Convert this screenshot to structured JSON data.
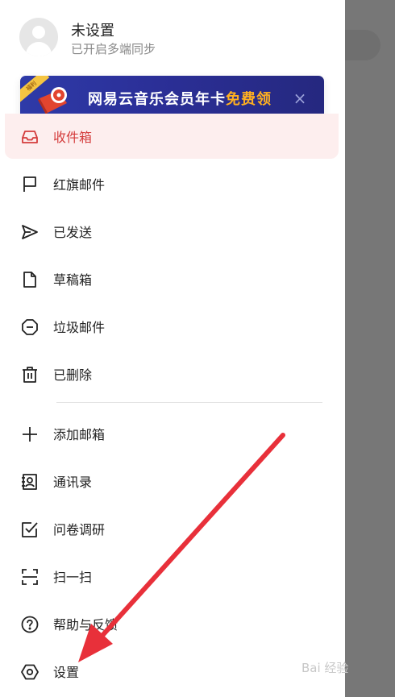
{
  "profile": {
    "name": "未设置",
    "status": "已开启多端同步"
  },
  "banner": {
    "tag": "福利",
    "title_main": "网易云音乐会员年卡",
    "title_highlight": "免费领",
    "close_symbol": "×"
  },
  "menu": {
    "items": [
      {
        "label": "收件箱",
        "icon": "inbox-icon",
        "active": true
      },
      {
        "label": "红旗邮件",
        "icon": "flag-icon"
      },
      {
        "label": "已发送",
        "icon": "send-icon"
      },
      {
        "label": "草稿箱",
        "icon": "draft-icon"
      },
      {
        "label": "垃圾邮件",
        "icon": "spam-icon"
      },
      {
        "label": "已删除",
        "icon": "trash-icon"
      },
      {
        "label": "添加邮箱",
        "icon": "plus-icon"
      },
      {
        "label": "通讯录",
        "icon": "contacts-icon"
      },
      {
        "label": "问卷调研",
        "icon": "survey-icon"
      },
      {
        "label": "扫一扫",
        "icon": "scan-icon"
      },
      {
        "label": "帮助与反馈",
        "icon": "help-icon"
      },
      {
        "label": "设置",
        "icon": "settings-icon"
      }
    ]
  },
  "watermark": "Bai 经验",
  "colors": {
    "accent": "#d43c3c",
    "active_bg": "#fdeeee",
    "banner_bg": "#2b2f97",
    "banner_highlight": "#ffb020",
    "annotation_arrow": "#e8303a",
    "overlay": "#777777"
  }
}
